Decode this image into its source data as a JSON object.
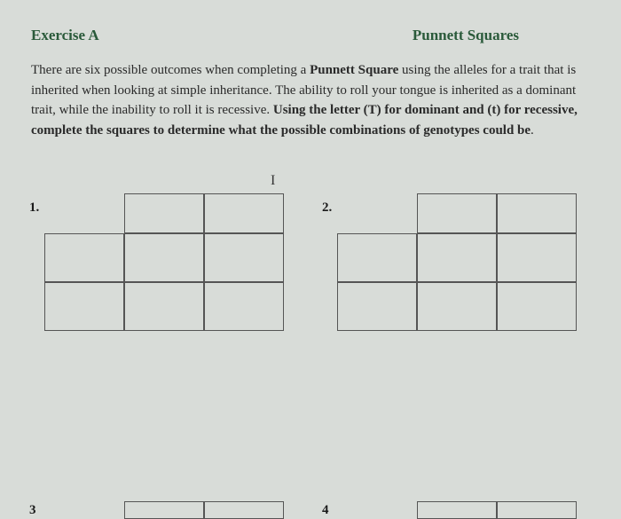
{
  "header": {
    "exercise": "Exercise A",
    "title": "Punnett Squares"
  },
  "instructions": {
    "part1": "There are six possible outcomes when completing a ",
    "bold1": "Punnett Square",
    "part2": " using the alleles for a trait that is inherited when looking at simple inheritance. The ability to roll your tongue is inherited as a dominant trait, while the inability to roll it is recessive. ",
    "bold2": "Using the letter (T) for dominant and (t) for recessive, complete the squares to determine what the possible combinations of genotypes could be",
    "part3": "."
  },
  "cursor": "I",
  "squares": {
    "one": "1.",
    "two": "2.",
    "three": "3",
    "four": "4"
  }
}
